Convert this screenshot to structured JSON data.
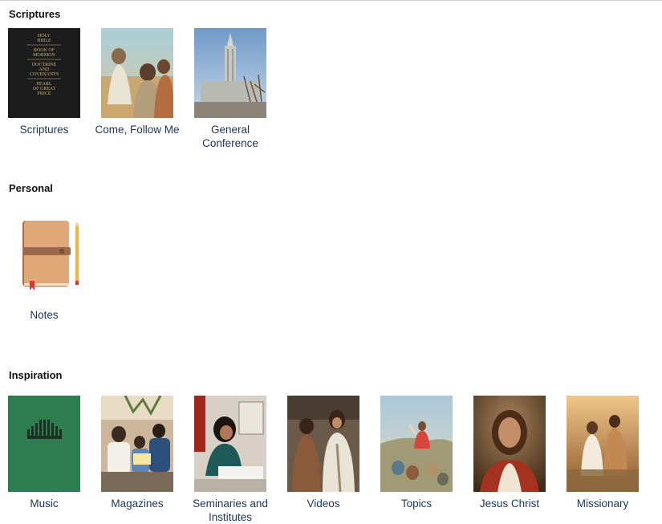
{
  "sections": {
    "scriptures": {
      "title": "Scriptures",
      "items": [
        {
          "label": "Scriptures",
          "cover_lines": [
            "HOLY",
            "BIBLE",
            "BOOK OF",
            "MORMON",
            "DOCTRINE",
            "AND",
            "COVENANTS",
            "PEARL",
            "OF GREAT",
            "PRICE"
          ]
        },
        {
          "label": "Come, Follow Me"
        },
        {
          "label": "General Conference"
        }
      ]
    },
    "personal": {
      "title": "Personal",
      "items": [
        {
          "label": "Notes"
        }
      ]
    },
    "inspiration": {
      "title": "Inspiration",
      "items": [
        {
          "label": "Music"
        },
        {
          "label": "Magazines"
        },
        {
          "label": "Seminaries and Institutes"
        },
        {
          "label": "Videos"
        },
        {
          "label": "Topics"
        },
        {
          "label": "Jesus Christ"
        },
        {
          "label": "Missionary"
        }
      ]
    }
  },
  "colors": {
    "label_text": "#1b3558",
    "scripture_cover": "#1c1c1c",
    "cover_gold": "#c9b277",
    "music_green": "#2e7d4f"
  }
}
